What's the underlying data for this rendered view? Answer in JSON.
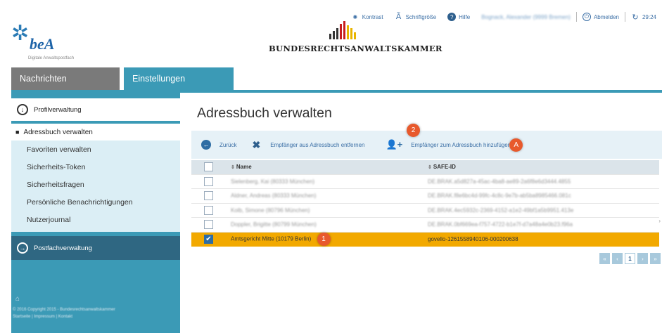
{
  "header": {
    "logo_text": "beA",
    "logo_subtitle": "Digitale Anwaltspostfach",
    "brak_name": "BUNDESRECHTSANWALTSKAMMER",
    "topbar": {
      "kontrast": "Kontrast",
      "schriftgroesse": "Schriftgröße",
      "hilfe": "Hilfe",
      "user": "Bognack, Alexander (9999 Bremen)",
      "abmelden": "Abmelden",
      "timer": "29:24"
    }
  },
  "nav": {
    "tabs": [
      "Nachrichten",
      "Einstellungen"
    ],
    "active_tab": "Einstellungen"
  },
  "sidebar": {
    "profil": "Profilverwaltung",
    "adressbuch_head": "Adressbuch verwalten",
    "links": [
      "Favoriten verwalten",
      "Sicherheits-Token",
      "Sicherheitsfragen",
      "Persönliche Benachrichtigungen",
      "Nutzerjournal"
    ],
    "postfach": "Postfachverwaltung",
    "footer_line1": "© 2016 Copyright 2015 - Bundesrechtsanwaltskammer",
    "footer_line2": "Startseite | Impressum | Kontakt"
  },
  "main": {
    "title": "Adressbuch verwalten",
    "toolbar": {
      "back": "Zurück",
      "remove": "Empfänger aus Adressbuch entfernen",
      "add": "Empfänger zum Adressbuch hinzufügen",
      "badge_remove": "2",
      "badge_add": "A"
    },
    "columns": [
      "Name",
      "SAFE-ID"
    ],
    "rows": [
      {
        "name": "Sielenberg, Kai (80333 München)",
        "safe_id": "DE.BRAK.a5d827a-45ac-4ba8-ae89-2a6f8e6d3444.4855",
        "checked": false
      },
      {
        "name": "Aldner, Andreas (80333 München)",
        "safe_id": "DE.BRAK.f8e6bc4d-99fc-4c8c-9e7b-ab5ba8985466.081c",
        "checked": false
      },
      {
        "name": "Kolb, Simone (80796 München)",
        "safe_id": "DE.BRAK.4ec5932c-2369-4152-a1e2-49bf1a5b9951.413e",
        "checked": false
      },
      {
        "name": "Doppler, Brigitte (80799 München)",
        "safe_id": "DE.BRAK.0bf669ea-f757-4722-b1e7f-d7a48a4e0b23.f96a",
        "checked": false
      },
      {
        "name": "Amtsgericht Mitte (10179 Berlin)",
        "safe_id": "govello-1261558940106-000200638",
        "checked": true,
        "badge": "1"
      }
    ],
    "pager": {
      "first": "«",
      "prev": "‹",
      "current": "1",
      "next": "›",
      "last": "»"
    }
  }
}
